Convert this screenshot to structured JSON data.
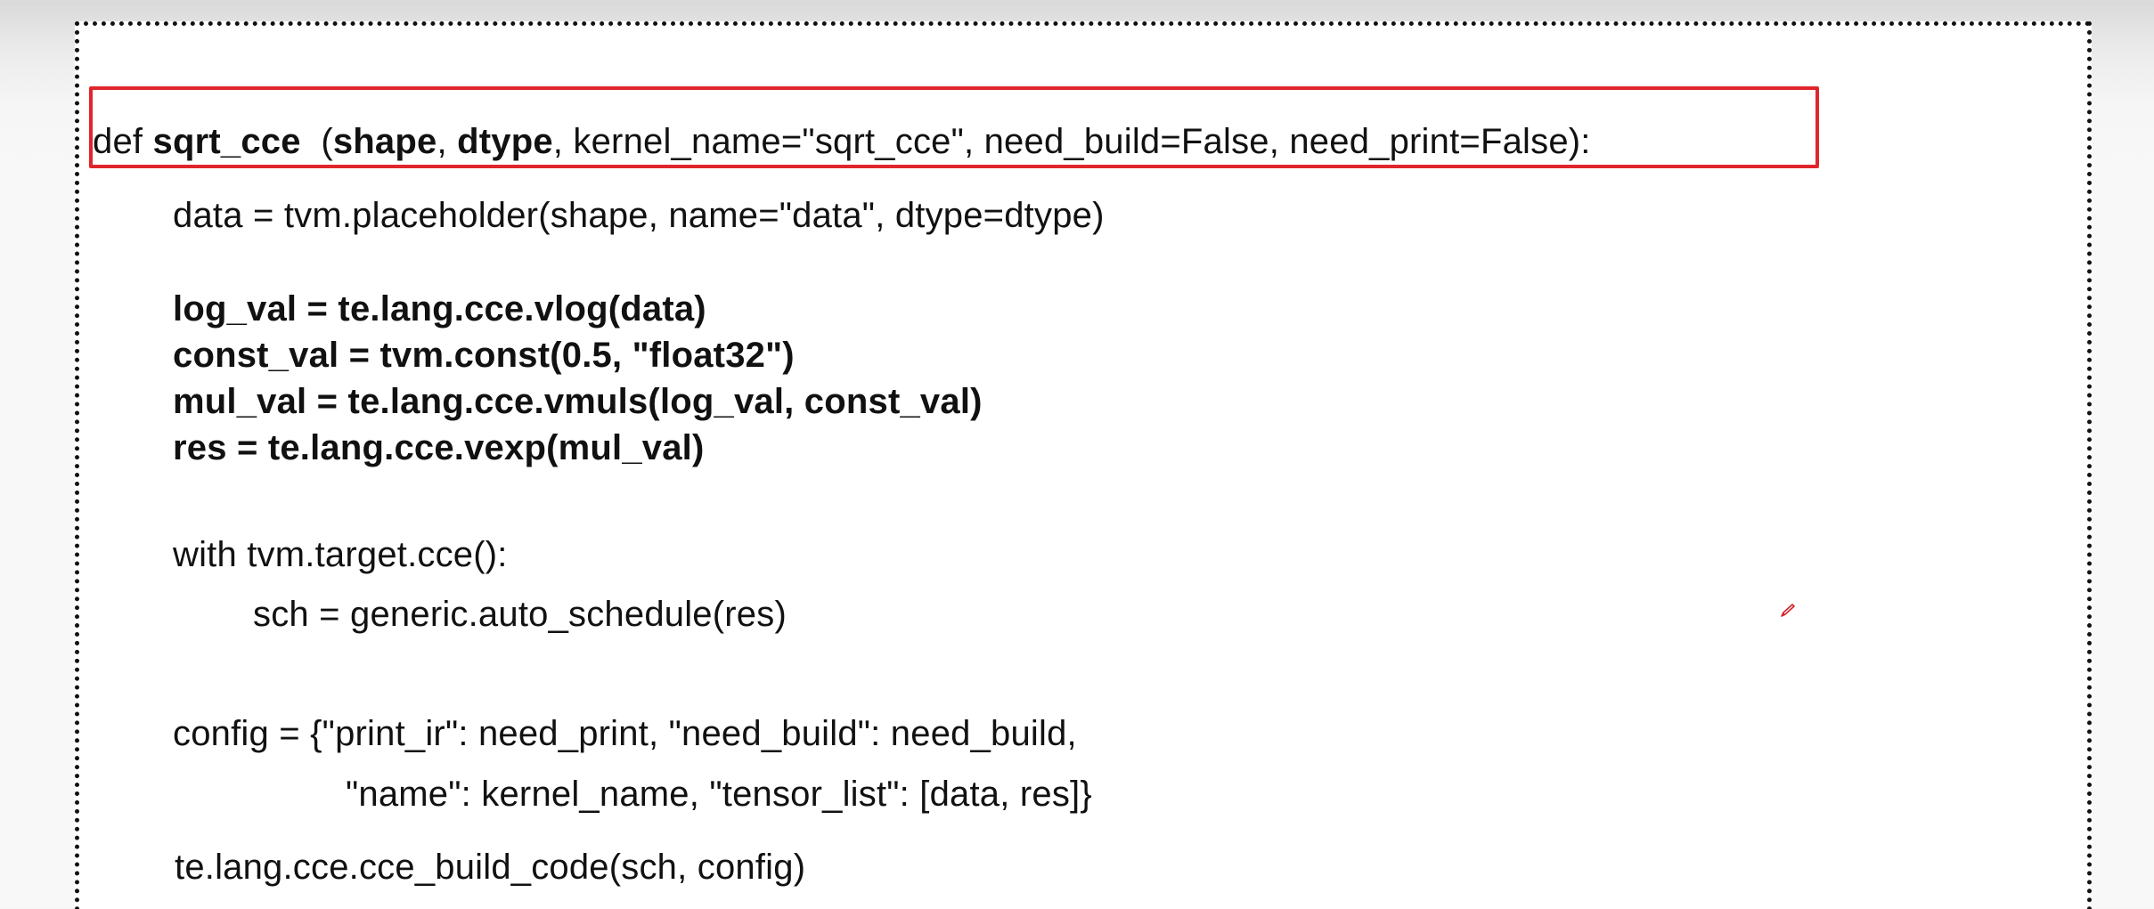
{
  "code": {
    "def_line": {
      "kw_def": "def ",
      "func_name": "sqrt_cce",
      "gap": "  (",
      "param_shape": "shape",
      "sep1": ", ",
      "param_dtype": "dtype",
      "rest": ", kernel_name=\"sqrt_cce\", need_build=False, need_print=False):"
    },
    "placeholder_line": "data = tvm.placeholder(shape, name=\"data\", dtype=dtype)",
    "compute_lines": [
      "log_val = te.lang.cce.vlog(data)",
      "const_val = tvm.const(0.5, \"float32\")",
      "mul_val = te.lang.cce.vmuls(log_val, const_val)",
      "res = te.lang.cce.vexp(mul_val)"
    ],
    "with_line": "with tvm.target.cce():",
    "schedule_line": "sch = generic.auto_schedule(res)",
    "config_line1": "config = {\"print_ir\": need_print, \"need_build\": need_build,",
    "config_line2": "\"name\": kernel_name, \"tensor_list\": [data, res]}",
    "build_line": "te.lang.cce.cce_build_code(sch, config)"
  },
  "colors": {
    "highlight_border": "#e0262c",
    "pen_icon": "#d4232b"
  },
  "icons": {
    "annotation": "pen-icon"
  }
}
